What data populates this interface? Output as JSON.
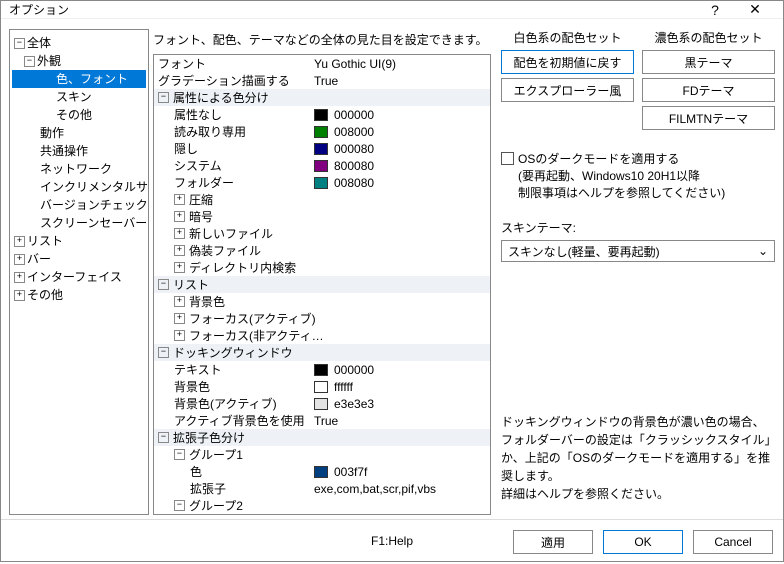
{
  "window": {
    "title": "オプション"
  },
  "tree": {
    "root": "全体",
    "appearance": "外観",
    "appearance_items": [
      "色、フォント",
      "スキン",
      "その他"
    ],
    "items1": [
      "動作",
      "共通操作",
      "ネットワーク",
      "インクリメンタルサー…",
      "バージョンチェック",
      "スクリーンセーバー"
    ],
    "roots": [
      "リスト",
      "バー",
      "インターフェイス",
      "その他"
    ]
  },
  "desc": "フォント、配色、テーマなどの全体の見た目を設定できます。",
  "props": {
    "font": {
      "k": "フォント",
      "v": "Yu Gothic UI(9)"
    },
    "grad": {
      "k": "グラデーション描画する",
      "v": "True"
    },
    "cat_attr": "属性による色分け",
    "attr_rows": [
      {
        "k": "属性なし",
        "v": "000000",
        "c": "#000000"
      },
      {
        "k": "読み取り専用",
        "v": "008000",
        "c": "#008000"
      },
      {
        "k": "隠し",
        "v": "000080",
        "c": "#000080"
      },
      {
        "k": "システム",
        "v": "800080",
        "c": "#800080"
      },
      {
        "k": "フォルダー",
        "v": "008080",
        "c": "#008080"
      }
    ],
    "attr_sub": [
      "圧縮",
      "暗号",
      "新しいファイル",
      "偽装ファイル",
      "ディレクトリ内検索"
    ],
    "cat_list": "リスト",
    "list_sub": [
      "背景色",
      "フォーカス(アクティブ)",
      "フォーカス(非アクティ…"
    ],
    "cat_dock": "ドッキングウィンドウ",
    "dock_rows": [
      {
        "k": "テキスト",
        "v": "000000",
        "c": "#000000"
      },
      {
        "k": "背景色",
        "v": "ffffff",
        "c": "#ffffff"
      },
      {
        "k": "背景色(アクティブ)",
        "v": "e3e3e3",
        "c": "#e3e3e3"
      }
    ],
    "dock_use": {
      "k": "アクティブ背景色を使用",
      "v": "True"
    },
    "cat_ext": "拡張子色分け",
    "ext1": "グループ1",
    "ext1_rows": [
      {
        "k": "色",
        "v": "003f7f",
        "c": "#003f7f"
      },
      {
        "k": "拡張子",
        "v": "exe,com,bat,scr,pif,vbs"
      }
    ],
    "ext2": "グループ2"
  },
  "right": {
    "light_h": "白色系の配色セット",
    "dark_h": "濃色系の配色セット",
    "light_btns": [
      "配色を初期値に戻す",
      "エクスプローラー風"
    ],
    "dark_btns": [
      "黒テーマ",
      "FDテーマ",
      "FILMTNテーマ"
    ],
    "darkmode": "OSのダークモードを適用する\n(要再起動、Windows10 20H1以降\n制限事項はヘルプを参照してください)",
    "skin_label": "スキンテーマ:",
    "skin_value": "スキンなし(軽量、要再起動)",
    "note": "ドッキングウィンドウの背景色が濃い色の場合、フォルダーバーの設定は「クラッシックスタイル」か、上記の「OSのダークモードを適用する」を推奨します。\n詳細はヘルプを参照ください。"
  },
  "footer": {
    "help": "F1:Help",
    "apply": "適用",
    "ok": "OK",
    "cancel": "Cancel"
  }
}
